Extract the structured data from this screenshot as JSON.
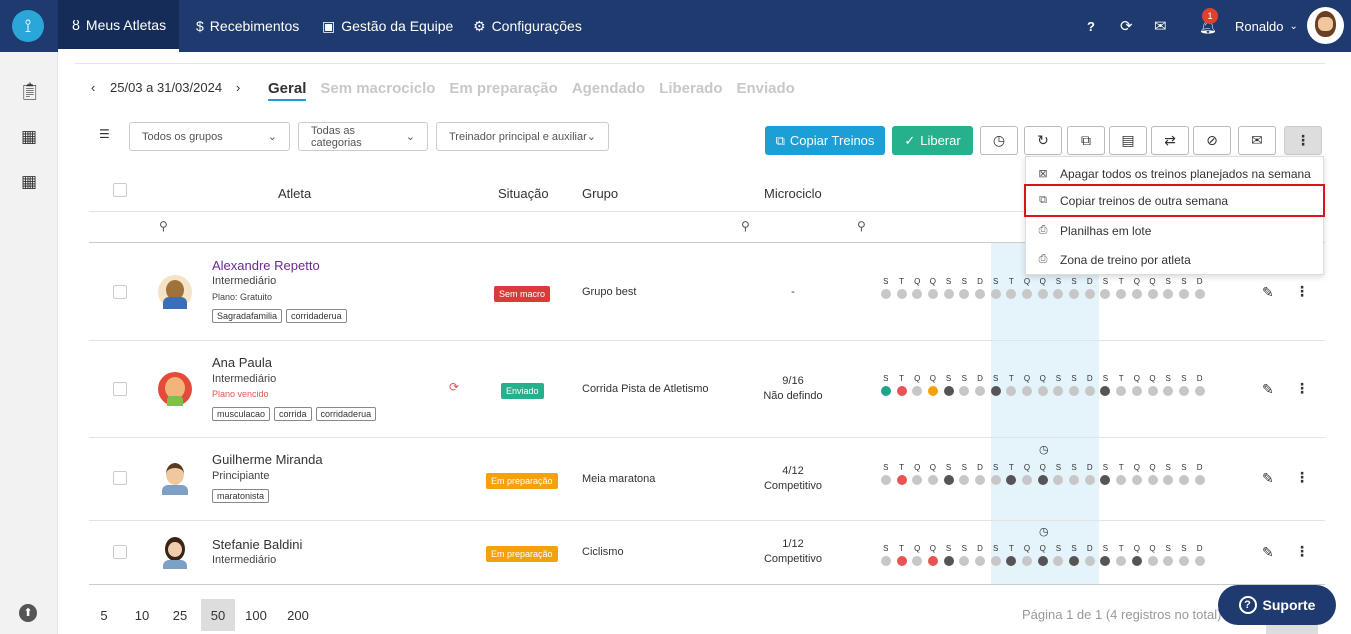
{
  "nav": {
    "tabs": [
      {
        "label": "Meus Atletas",
        "icon": "medal-icon"
      },
      {
        "label": "Recebimentos",
        "icon": "dollar-icon"
      },
      {
        "label": "Gestão da Equipe",
        "icon": "id-card-icon"
      },
      {
        "label": "Configurações",
        "icon": "gears-icon"
      }
    ],
    "user_name": "Ronaldo",
    "notification_count": "1"
  },
  "date_range": "25/03 a 31/03/2024",
  "status_tabs": [
    "Geral",
    "Sem macrociclo",
    "Em preparação",
    "Agendado",
    "Liberado",
    "Enviado"
  ],
  "filters": {
    "groups": "Todos os grupos",
    "categories": "Todas as categorias",
    "coach": "Treinador principal e auxiliar"
  },
  "toolbar": {
    "copy_label": "Copiar Treinos",
    "release_label": "Liberar"
  },
  "columns": {
    "athlete": "Atleta",
    "status": "Situação",
    "group": "Grupo",
    "microcycle": "Microciclo"
  },
  "menu": {
    "items": [
      "Apagar todos os treinos planejados na semana",
      "Copiar treinos de outra semana",
      "Planilhas em lote",
      "Zona de treino por atleta"
    ]
  },
  "day_letters": [
    "S",
    "T",
    "Q",
    "Q",
    "S",
    "S",
    "D"
  ],
  "colors": {
    "gray": "#c7c7c7",
    "dark": "#555555",
    "red": "#e85454",
    "green": "#1ea58a",
    "orange": "#f3a20e"
  },
  "athletes": [
    {
      "name": "Alexandre Repetto",
      "level": "Intermediário",
      "plan": "Plano: Gratuito",
      "tags": [
        "Sagradafamilia",
        "corridaderua"
      ],
      "status": "Sem macro",
      "status_color": "#d93b3b",
      "group": "Grupo best",
      "micro1": "-",
      "micro2": "",
      "dots": [
        "gray",
        "gray",
        "gray",
        "gray",
        "gray",
        "gray",
        "gray",
        "gray",
        "gray",
        "gray",
        "gray",
        "gray",
        "gray",
        "gray",
        "gray",
        "gray",
        "gray",
        "gray",
        "gray",
        "gray",
        "gray"
      ]
    },
    {
      "name": "Ana Paula",
      "level": "Intermediário",
      "plan": "Plano vencido",
      "tags": [
        "musculacao",
        "corrida",
        "corridaderua"
      ],
      "status": "Enviado",
      "status_color": "#27b08c",
      "group": "Corrida Pista de Atletismo",
      "micro1": "9/16",
      "micro2": "Não defindo",
      "dots": [
        "green",
        "red",
        "gray",
        "orange",
        "dark",
        "gray",
        "gray",
        "dark",
        "gray",
        "gray",
        "gray",
        "gray",
        "gray",
        "gray",
        "dark",
        "gray",
        "gray",
        "gray",
        "gray",
        "gray",
        "gray"
      ]
    },
    {
      "name": "Guilherme Miranda",
      "level": "Principiante",
      "plan": "",
      "tags": [
        "maratonista"
      ],
      "status": "Em preparação",
      "status_color": "#f3a20e",
      "group": "Meia maratona",
      "micro1": "4/12",
      "micro2": "Competitivo",
      "dots": [
        "gray",
        "red",
        "gray",
        "gray",
        "dark",
        "gray",
        "gray",
        "gray",
        "dark",
        "gray",
        "dark",
        "gray",
        "gray",
        "gray",
        "dark",
        "gray",
        "gray",
        "gray",
        "gray",
        "gray",
        "gray"
      ]
    },
    {
      "name": "Stefanie Baldini",
      "level": "Intermediário",
      "plan": "",
      "tags": [],
      "status": "Em preparação",
      "status_color": "#f3a20e",
      "group": "Ciclismo",
      "micro1": "1/12",
      "micro2": "Competitivo",
      "dots": [
        "gray",
        "red",
        "gray",
        "red",
        "dark",
        "gray",
        "gray",
        "gray",
        "dark",
        "gray",
        "dark",
        "gray",
        "dark",
        "gray",
        "dark",
        "gray",
        "dark",
        "gray",
        "gray",
        "gray",
        "gray"
      ]
    }
  ],
  "pagination": {
    "sizes": [
      "5",
      "10",
      "25",
      "50",
      "100",
      "200"
    ],
    "active": "50",
    "summary": "Página 1 de 1 (4 registros no total)"
  },
  "support_label": "Suporte"
}
